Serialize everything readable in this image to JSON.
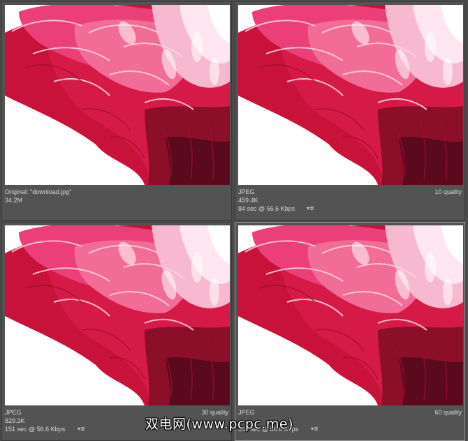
{
  "panes": [
    {
      "line1": "Original: \"download.jpg\"",
      "line2": "34.2M",
      "line3": "",
      "quality": ""
    },
    {
      "line1": "JPEG",
      "line2": "459.4K",
      "line3": "84 sec @ 56.6 Kbps",
      "quality": "10 quality"
    },
    {
      "line1": "JPEG",
      "line2": "829.3K",
      "line3": "151 sec @ 56.6 Kbps",
      "quality": "30 quality"
    },
    {
      "line1": "JPEG",
      "line2": "",
      "line3": "340 sec @ 56.6 Kbps",
      "quality": "60 quality"
    }
  ],
  "icons": {
    "optimize_menu": "▾≣"
  },
  "watermark": "双电网(www.pcpc.me)",
  "colors": {
    "background": "#4a4a4a",
    "pane": "#535353",
    "selected_border": "#9a9a9a",
    "info_text": "#d8d8d8"
  }
}
